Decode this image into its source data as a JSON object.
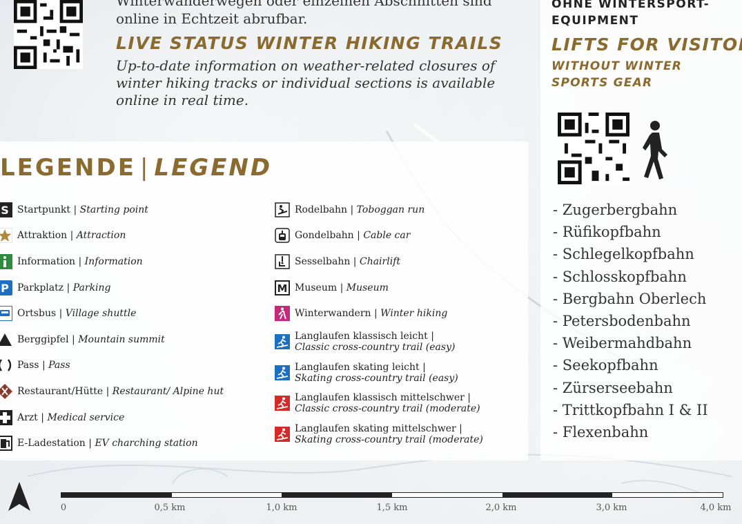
{
  "top": {
    "text_de_line": "Winterwanderwegen oder einzelnen Abschnitten sind",
    "text_de_line2": "online in Echtzeit abrufbar.",
    "heading_en": "LIVE STATUS WINTER HIKING TRAILS",
    "text_en_1": "Up-to-date information on weather-related closures of",
    "text_en_2": "winter hiking tracks or individual sections is available",
    "text_en_3": "online in real time."
  },
  "legend": {
    "title_de": "LEGENDE",
    "separator": "|",
    "title_en": "LEGEND",
    "left": [
      {
        "de": "Startpunkt",
        "en": "Starting point",
        "icon": "start-s-icon",
        "color": "#222222"
      },
      {
        "de": "Attraktion",
        "en": "Attraction",
        "icon": "star-icon",
        "color": "#b08a3a"
      },
      {
        "de": "Information",
        "en": "Information",
        "icon": "info-icon",
        "color": "#2e8a3c"
      },
      {
        "de": "Parkplatz",
        "en": "Parking",
        "icon": "parking-icon",
        "color": "#1d6fc2"
      },
      {
        "de": "Ortsbus",
        "en": "Village shuttle",
        "icon": "bus-icon",
        "color": "#1d6fc2"
      },
      {
        "de": "Berggipfel",
        "en": "Mountain summit",
        "icon": "summit-icon",
        "color": "#222222"
      },
      {
        "de": "Pass",
        "en": "Pass",
        "icon": "pass-icon",
        "color": "#222222"
      },
      {
        "de": "Restaurant/Hütte",
        "en": "Restaurant/ Alpine hut",
        "icon": "restaurant-icon",
        "color": "#8a3a2a"
      },
      {
        "de": "Arzt",
        "en": "Medical service",
        "icon": "medical-cross-icon",
        "color": "#222222"
      },
      {
        "de": "E-Ladestation",
        "en": "EV charching station",
        "icon": "ev-charging-icon",
        "color": "#222222"
      }
    ],
    "right": [
      {
        "de": "Rodelbahn",
        "en": "Toboggan run",
        "icon": "toboggan-icon",
        "color": "#222222"
      },
      {
        "de": "Gondelbahn",
        "en": "Cable car",
        "icon": "gondola-icon",
        "color": "#222222"
      },
      {
        "de": "Sesselbahn",
        "en": "Chairlift",
        "icon": "chairlift-icon",
        "color": "#222222"
      },
      {
        "de": "Museum",
        "en": "Museum",
        "icon": "museum-icon",
        "color": "#222222"
      },
      {
        "de": "Winterwandern",
        "en": "Winter hiking",
        "icon": "winter-hiking-icon",
        "color": "#c8287a"
      },
      {
        "de": "Langlaufen klassisch leicht |",
        "en": "Classic cross-country trail (easy)",
        "icon": "xc-classic-easy-icon",
        "color": "#1d6fc2"
      },
      {
        "de": "Langlaufen skating leicht |",
        "en": "Skating cross-country trail (easy)",
        "icon": "xc-skating-easy-icon",
        "color": "#1d6fc2"
      },
      {
        "de": "Langlaufen klassisch mittelschwer |",
        "en": "Classic cross-country trail (moderate)",
        "icon": "xc-classic-moderate-icon",
        "color": "#d42a2a"
      },
      {
        "de": "Langlaufen skating mittelschwer |",
        "en": "Skating cross-country trail (moderate)",
        "icon": "xc-skating-moderate-icon",
        "color": "#d42a2a"
      }
    ]
  },
  "right_panel": {
    "heading_de_1": "OHNE WINTERSPORT-",
    "heading_de_2": "EQUIPMENT",
    "heading_en_1": "LIFTS FOR VISITORS",
    "heading_en_2": "WITHOUT WINTER",
    "heading_en_3": "SPORTS GEAR",
    "lifts": [
      "- Zugerbergbahn",
      "- Rüfikopfbahn",
      "- Schlegelkopfbahn",
      "- Schlosskopfbahn",
      "- Bergbahn Oberlech",
      "- Petersbodenbahn",
      "- Weibermahdbahn",
      "- Seekopfbahn",
      "- Zürserseebahn",
      "- Trittkopfbahn I & II",
      "- Flexenbahn"
    ]
  },
  "scale": {
    "ticks": [
      "0",
      "0,5 km",
      "1,0 km",
      "1,5 km",
      "2,0 km",
      "3,0 km",
      "4,0 km"
    ]
  },
  "colors": {
    "accent": "#8a6a2e"
  }
}
